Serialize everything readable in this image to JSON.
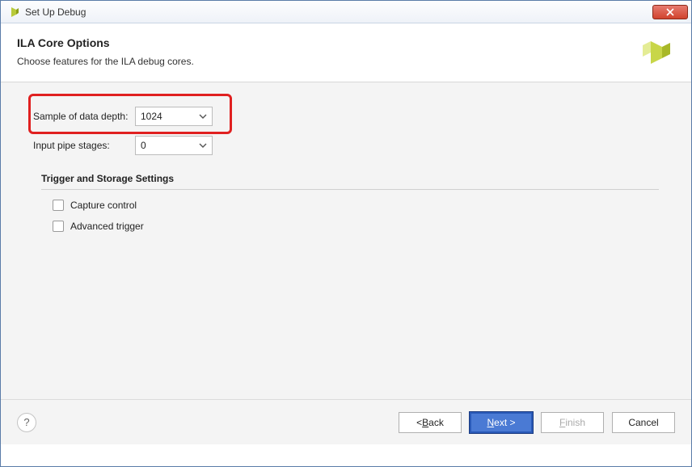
{
  "window": {
    "title": "Set Up Debug"
  },
  "banner": {
    "title": "ILA Core Options",
    "subtitle": "Choose features for the ILA debug cores."
  },
  "form": {
    "sample_depth_label": "Sample of data depth:",
    "sample_depth_value": "1024",
    "pipe_stages_label": "Input pipe stages:",
    "pipe_stages_value": "0"
  },
  "section": {
    "title": "Trigger and Storage Settings",
    "capture_control": "Capture control",
    "advanced_trigger": "Advanced trigger"
  },
  "footer": {
    "help": "?",
    "back_prefix": "< ",
    "back_mnemonic": "B",
    "back_suffix": "ack",
    "next_mnemonic": "N",
    "next_suffix": "ext >",
    "finish_mnemonic": "F",
    "finish_suffix": "inish",
    "cancel": "Cancel"
  }
}
